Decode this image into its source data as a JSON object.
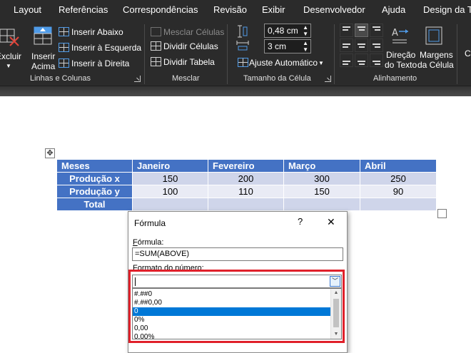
{
  "ribbon": {
    "tabs": [
      "Layout",
      "Referências",
      "Correspondências",
      "Revisão",
      "Exibir",
      "Desenvolvedor",
      "Ajuda",
      "Design da Ta"
    ],
    "rows_cols": {
      "delete_label": "Excluir",
      "insert_above_line1": "Inserir",
      "insert_above_line2": "Acima",
      "insert_below": "Inserir Abaixo",
      "insert_left": "Inserir à Esquerda",
      "insert_right": "Inserir à Direita",
      "group_label": "Linhas e Colunas"
    },
    "merge": {
      "merge_cells": "Mesclar Células",
      "split_cells": "Dividir Células",
      "split_table": "Dividir Tabela",
      "group_label": "Mesclar"
    },
    "cell_size": {
      "height_value": "0,48 cm",
      "width_value": "3 cm",
      "autofit": "Ajuste Automático",
      "group_label": "Tamanho da Célula"
    },
    "alignment": {
      "text_direction_line1": "Direção",
      "text_direction_line2": "do Texto",
      "cell_margins_line1": "Margens",
      "cell_margins_line2": "da Célula",
      "group_label": "Alinhamento",
      "cut_label": "C"
    }
  },
  "document": {
    "table": {
      "headers": [
        "Meses",
        "Janeiro",
        "Fevereiro",
        "Março",
        "Abril"
      ],
      "rows": [
        {
          "label": "Produção x",
          "values": [
            "150",
            "200",
            "300",
            "250"
          ]
        },
        {
          "label": "Produção y",
          "values": [
            "100",
            "110",
            "150",
            "90"
          ]
        },
        {
          "label": "Total",
          "values": [
            "",
            "",
            "",
            ""
          ]
        }
      ]
    }
  },
  "dialog": {
    "title": "Fórmula",
    "help": "?",
    "close": "✕",
    "formula_label_first": "F",
    "formula_label_rest": "órmula:",
    "formula_value": "=SUM(ABOVE)",
    "number_format_label": "Formato do número:",
    "number_format_value": "",
    "options": [
      "#.##0",
      "#.##0,00",
      "0",
      "0%",
      "0,00",
      "0,00%"
    ],
    "selected_index": 2
  },
  "colors": {
    "ribbon_bg": "#2b2b2b",
    "table_header": "#4472c4",
    "band_dark": "#cfd5ea",
    "band_light": "#e9ebf5",
    "selection": "#0078d7",
    "highlight": "#e0202a"
  }
}
